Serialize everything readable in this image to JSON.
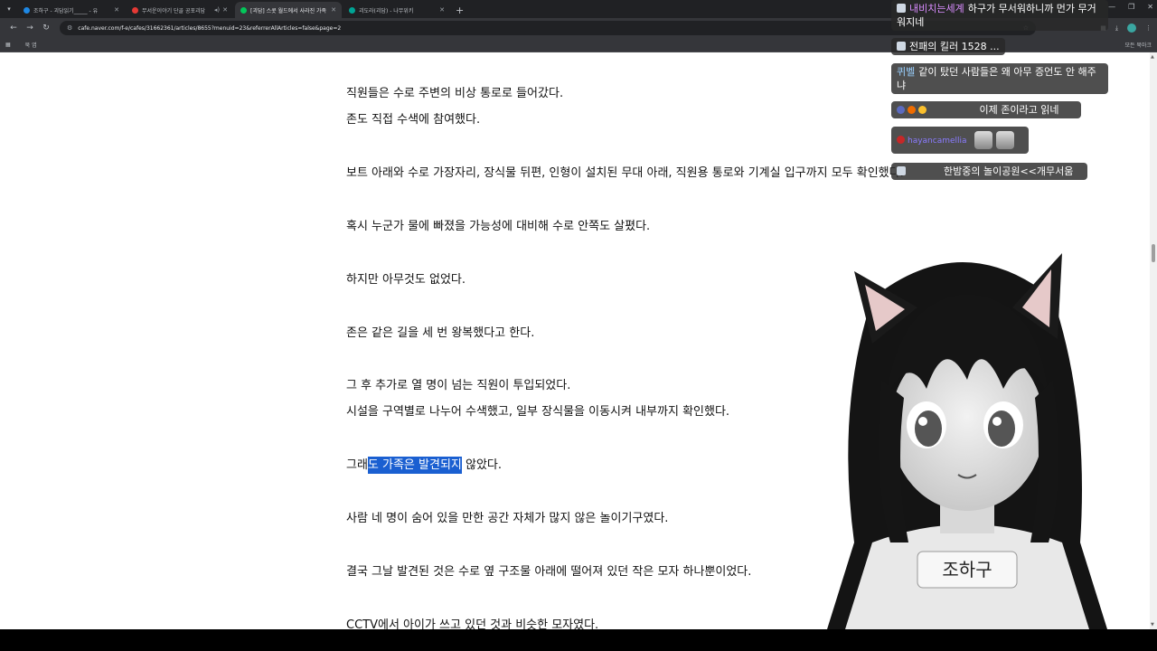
{
  "browser": {
    "tabs": [
      {
        "title": "조하구 - 괴담읽기_____ - 유",
        "active": false,
        "fav": "#1e88e5"
      },
      {
        "title": "무서운이야기 단골 공포괴담",
        "active": false,
        "fav": "#e53935",
        "speaker": true
      },
      {
        "title": "[괴담] 스콧 월드에서 사라진 가족",
        "active": true,
        "fav": "#03c75a"
      },
      {
        "title": "괴도라(괴담) - 나무위키",
        "active": false,
        "fav": "#00a495"
      }
    ],
    "url": "cafe.naver.com/f-e/cafes/31662361/articles/8655?menuid=23&referrerAllArticles=false&page=2",
    "bookmark": "북 엽",
    "all_bookmarks": "모든 북마크"
  },
  "article": {
    "lines": [
      "직원들은 수로 주변의 비상 통로로 들어갔다.",
      "존도 직접 수색에 참여했다.",
      "보트 아래와 수로 가장자리, 장식물 뒤편, 인형이 설치된 무대 아래, 직원용 통로와 기계실 입구까지 모두 확인했다.",
      "혹시 누군가 물에 빠졌을 가능성에 대비해 수로 안쪽도 살폈다.",
      "하지만 아무것도 없었다.",
      "존은 같은 길을 세 번 왕복했다고 한다.",
      "그 후 추가로 열 명이 넘는 직원이 투입되었다.",
      "시설을 구역별로 나누어 수색했고, 일부 장식물을 이동시켜 내부까지 확인했다.",
      "사람 네 명이 숨어 있을 만한 공간 자체가 많지 않은 놀이기구였다.",
      "결국 그날 발견된 것은 수로 옆 구조물 아래에 떨어져 있던 작은 모자 하나뿐이었다.",
      "CCTV에서 아이가 쓰고 있던 것과 비슷한 모자였다."
    ],
    "selected_line": {
      "before": "그래",
      "selected": "도 가족은 발견되지",
      "after": " 않았다."
    }
  },
  "chat": [
    {
      "nick": "내비치는세계",
      "nick_color": "#d98cff",
      "text": "하구가 무서워하니까 먼가 무거워지네"
    },
    {
      "nick": "",
      "nick_color": "#ffffff",
      "text": "전패의 킬러 1528 ..."
    },
    {
      "nick": "퀴벨",
      "nick_color": "#9ad0ff",
      "text": "같이 탔던 사람들은 왜 아무 증언도 안 해주냐"
    },
    {
      "nick": "",
      "nick_color": "#ffffff",
      "text": "이제 존이라고 읽네"
    },
    {
      "nick": "hayancamellia",
      "nick_color": "#8a7bff",
      "text": ""
    },
    {
      "nick": "",
      "nick_color": "#ffffff",
      "text": "한밤중의 놀이공원<<개무서움"
    }
  ],
  "avatar": {
    "name_tag": "조하구"
  }
}
